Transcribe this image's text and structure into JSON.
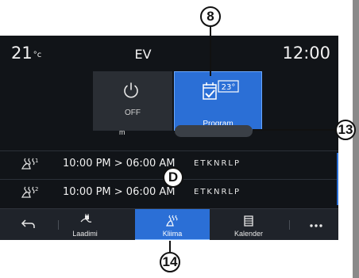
{
  "status_bar": {
    "temperature": "21",
    "temp_unit": "°c",
    "title": "EV",
    "time": "12:00"
  },
  "mode_tiles": {
    "off": {
      "label": "OFF",
      "icon": "power-icon"
    },
    "program": {
      "label": "Program",
      "icon": "calendar-check-icon",
      "setpoint": "23°"
    },
    "sub_label": "m"
  },
  "programs": [
    {
      "index": "1",
      "time_range": "10:00 PM > 06:00 AM",
      "days": "ETKNRLP",
      "icon": "seat-heat-icon"
    },
    {
      "index": "2",
      "time_range": "10:00 PM > 06:00 AM",
      "days": "ETKNRLP",
      "icon": "seat-heat-icon"
    }
  ],
  "navbar": {
    "items": [
      {
        "label": "",
        "icon": "back-icon"
      },
      {
        "label": "Laadimi",
        "icon": "charging-plug-icon"
      },
      {
        "label": "Kliima",
        "icon": "seat-heat-icon",
        "active": true
      },
      {
        "label": "Kalender",
        "icon": "calendar-icon"
      },
      {
        "label": "",
        "icon": "more-icon"
      }
    ]
  },
  "callouts": {
    "c8": "8",
    "c13": "13",
    "c14": "14",
    "cD": "D"
  },
  "colors": {
    "accent": "#2b6fd6",
    "screen_bg": "#111418",
    "tile_bg": "#2a2e34"
  }
}
